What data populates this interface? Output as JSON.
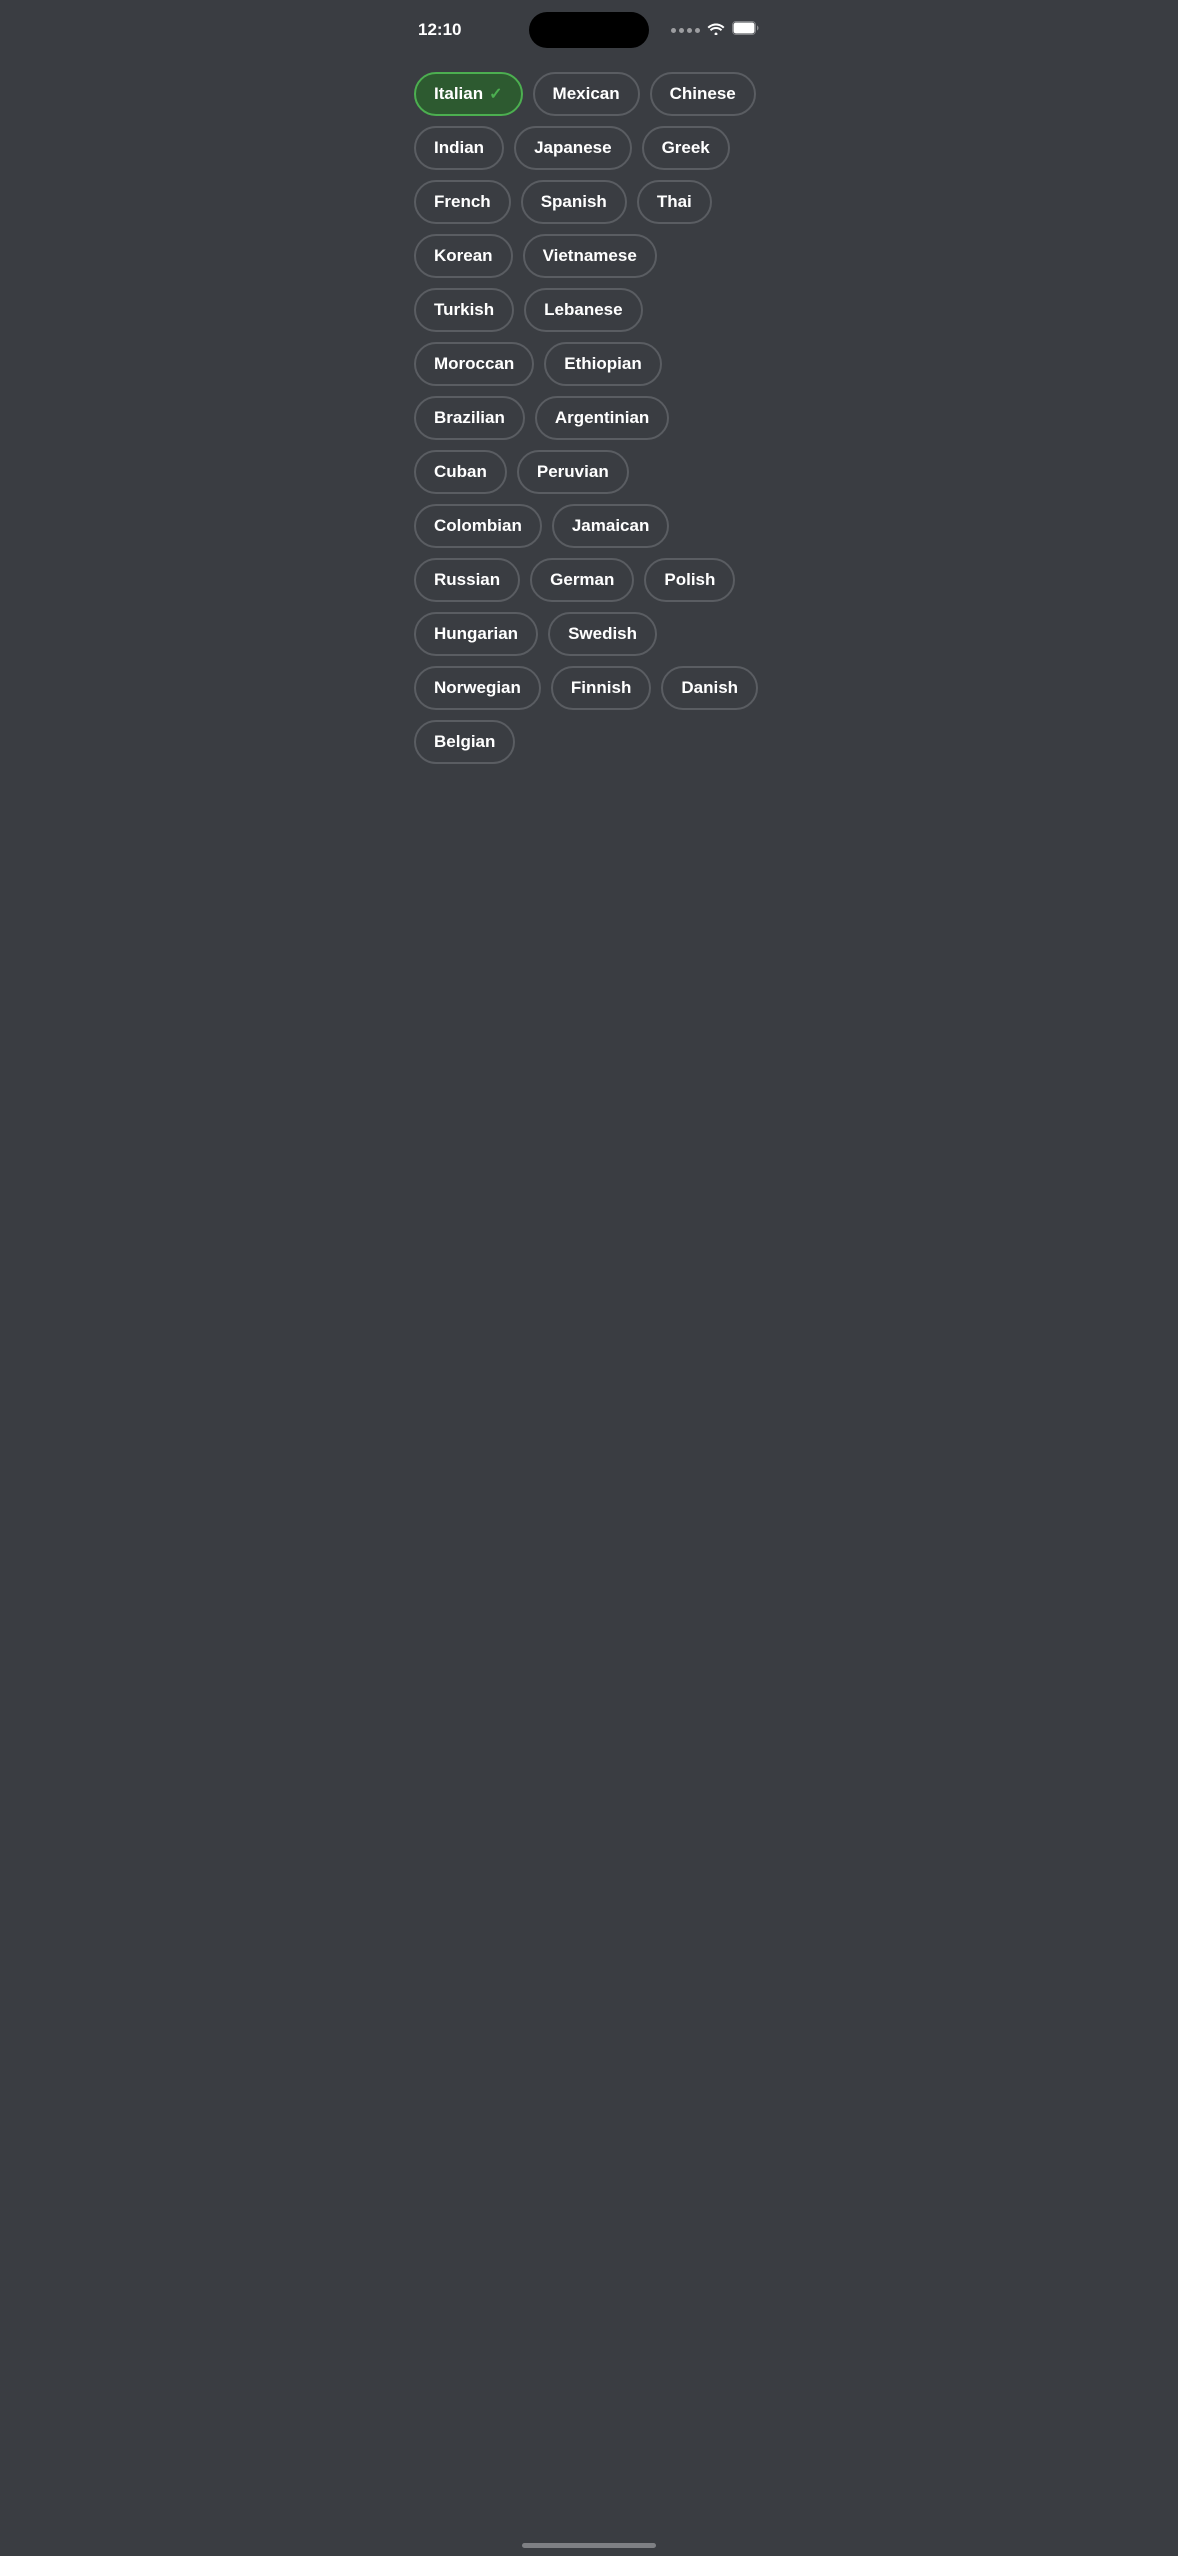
{
  "statusBar": {
    "time": "12:10",
    "icons": {
      "wifi": "wifi-icon",
      "battery": "battery-icon",
      "signal": "signal-icon"
    }
  },
  "tags": [
    {
      "id": "italian",
      "label": "Italian",
      "selected": true
    },
    {
      "id": "mexican",
      "label": "Mexican",
      "selected": false
    },
    {
      "id": "chinese",
      "label": "Chinese",
      "selected": false
    },
    {
      "id": "indian",
      "label": "Indian",
      "selected": false
    },
    {
      "id": "japanese",
      "label": "Japanese",
      "selected": false
    },
    {
      "id": "greek",
      "label": "Greek",
      "selected": false
    },
    {
      "id": "french",
      "label": "French",
      "selected": false
    },
    {
      "id": "spanish",
      "label": "Spanish",
      "selected": false
    },
    {
      "id": "thai",
      "label": "Thai",
      "selected": false
    },
    {
      "id": "korean",
      "label": "Korean",
      "selected": false
    },
    {
      "id": "vietnamese",
      "label": "Vietnamese",
      "selected": false
    },
    {
      "id": "turkish",
      "label": "Turkish",
      "selected": false
    },
    {
      "id": "lebanese",
      "label": "Lebanese",
      "selected": false
    },
    {
      "id": "moroccan",
      "label": "Moroccan",
      "selected": false
    },
    {
      "id": "ethiopian",
      "label": "Ethiopian",
      "selected": false
    },
    {
      "id": "brazilian",
      "label": "Brazilian",
      "selected": false
    },
    {
      "id": "argentinian",
      "label": "Argentinian",
      "selected": false
    },
    {
      "id": "cuban",
      "label": "Cuban",
      "selected": false
    },
    {
      "id": "peruvian",
      "label": "Peruvian",
      "selected": false
    },
    {
      "id": "colombian",
      "label": "Colombian",
      "selected": false
    },
    {
      "id": "jamaican",
      "label": "Jamaican",
      "selected": false
    },
    {
      "id": "russian",
      "label": "Russian",
      "selected": false
    },
    {
      "id": "german",
      "label": "German",
      "selected": false
    },
    {
      "id": "polish",
      "label": "Polish",
      "selected": false
    },
    {
      "id": "hungarian",
      "label": "Hungarian",
      "selected": false
    },
    {
      "id": "swedish",
      "label": "Swedish",
      "selected": false
    },
    {
      "id": "norwegian",
      "label": "Norwegian",
      "selected": false
    },
    {
      "id": "finnish",
      "label": "Finnish",
      "selected": false
    },
    {
      "id": "danish",
      "label": "Danish",
      "selected": false
    },
    {
      "id": "belgian",
      "label": "Belgian",
      "selected": false
    }
  ]
}
